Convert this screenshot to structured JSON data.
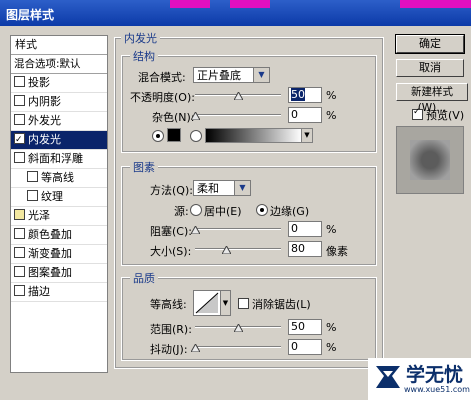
{
  "window": {
    "title": "图层样式"
  },
  "styles_panel": {
    "header": "样式",
    "blend_options": "混合选项:默认",
    "items": [
      {
        "label": "投影",
        "checked": false,
        "indent": false,
        "selected": false
      },
      {
        "label": "内阴影",
        "checked": false,
        "indent": false,
        "selected": false
      },
      {
        "label": "外发光",
        "checked": false,
        "indent": false,
        "selected": false
      },
      {
        "label": "内发光",
        "checked": true,
        "indent": false,
        "selected": true
      },
      {
        "label": "斜面和浮雕",
        "checked": false,
        "indent": false,
        "selected": false
      },
      {
        "label": "等高线",
        "checked": false,
        "indent": true,
        "selected": false
      },
      {
        "label": "纹理",
        "checked": false,
        "indent": true,
        "selected": false
      },
      {
        "label": "光泽",
        "checked": false,
        "indent": false,
        "selected": false
      },
      {
        "label": "颜色叠加",
        "checked": false,
        "indent": false,
        "selected": false
      },
      {
        "label": "渐变叠加",
        "checked": false,
        "indent": false,
        "selected": false
      },
      {
        "label": "图案叠加",
        "checked": false,
        "indent": false,
        "selected": false
      },
      {
        "label": "描边",
        "checked": false,
        "indent": false,
        "selected": false
      }
    ]
  },
  "inner_glow": {
    "title": "内发光",
    "structure": {
      "title": "结构",
      "blend_mode_label": "混合模式:",
      "blend_mode_value": "正片叠底",
      "opacity_label": "不透明度(O):",
      "opacity_value": "50",
      "noise_label": "杂色(N):",
      "noise_value": "0",
      "percent": "%"
    },
    "elements": {
      "title": "图素",
      "method_label": "方法(Q):",
      "method_value": "柔和",
      "source_label": "源:",
      "source_center": "居中(E)",
      "source_edge": "边缘(G)",
      "choke_label": "阻塞(C):",
      "choke_value": "0",
      "size_label": "大小(S):",
      "size_value": "80",
      "size_unit": "像素",
      "percent": "%"
    },
    "quality": {
      "title": "品质",
      "contour_label": "等高线:",
      "antialias_label": "消除锯齿(L)",
      "range_label": "范围(R):",
      "range_value": "50",
      "jitter_label": "抖动(J):",
      "jitter_value": "0",
      "percent": "%"
    }
  },
  "buttons": {
    "ok": "确定",
    "cancel": "取消",
    "new_style": "新建样式(W)...",
    "preview": "预览(V)"
  },
  "watermark": {
    "brand": "学无忧",
    "url": "www.xue51.com"
  },
  "colors": {
    "selection": "#0a246a",
    "titlebar": "#0c3aa8",
    "dialog": "#d4d0c8"
  }
}
